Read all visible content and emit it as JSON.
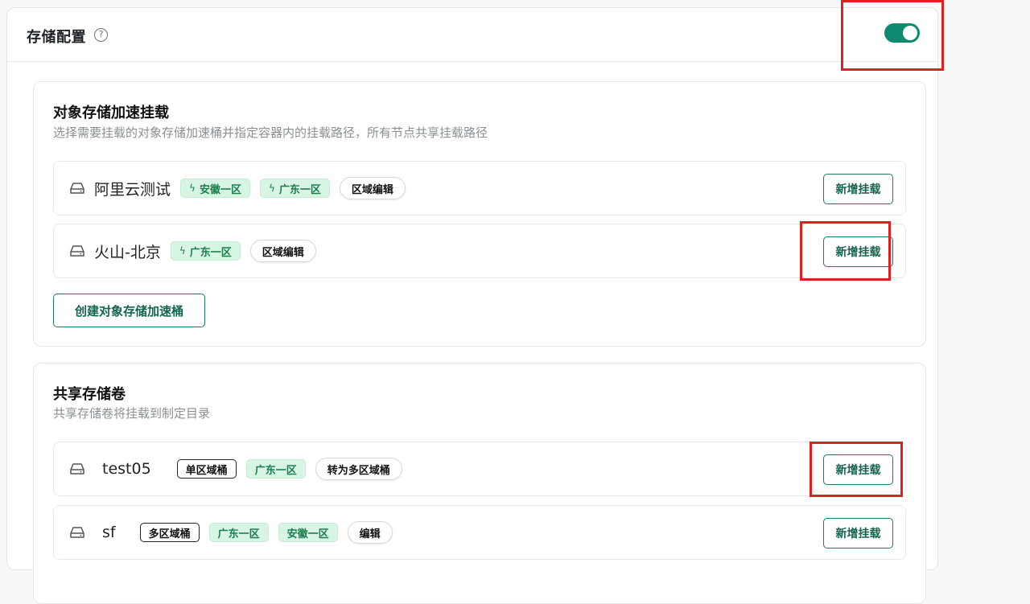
{
  "storage": {
    "title": "存储配置",
    "help_icon": "?",
    "enabled": true
  },
  "object_storage": {
    "title": "对象存储加速挂载",
    "description": "选择需要挂载的对象存储加速桶并指定容器内的挂载路径，所有节点共享挂载路径",
    "rows": [
      {
        "name": "阿里云测试",
        "tags": [
          "安徽一区",
          "广东一区"
        ],
        "edit_label": "区域编辑",
        "mount_label": "新增挂载"
      },
      {
        "name": "火山-北京",
        "tags": [
          "广东一区"
        ],
        "edit_label": "区域编辑",
        "mount_label": "新增挂载"
      }
    ],
    "create_label": "创建对象存储加速桶"
  },
  "shared_volume": {
    "title": "共享存储卷",
    "description": "共享存储卷将挂载到制定目录",
    "rows": [
      {
        "name": "test05",
        "type_label": "单区域桶",
        "tags": [
          "广东一区"
        ],
        "action_label": "转为多区域桶",
        "mount_label": "新增挂载"
      },
      {
        "name": "sf",
        "type_label": "多区域桶",
        "tags": [
          "广东一区",
          "安徽一区"
        ],
        "action_label": "编辑",
        "mount_label": "新增挂载"
      }
    ]
  },
  "icons": {
    "bolt": "ϟ",
    "drive": "hard-drive-icon"
  },
  "colors": {
    "accent": "#0e8a70",
    "tag_bg": "#d8f5e4",
    "tag_text": "#1b7f4c",
    "highlight": "#e02020"
  }
}
